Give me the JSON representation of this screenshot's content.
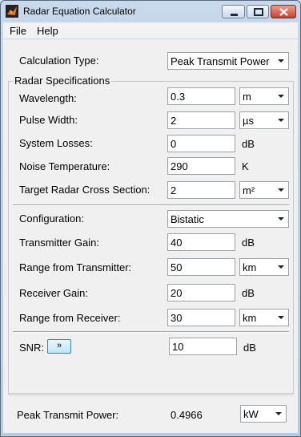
{
  "window": {
    "title": "Radar Equation Calculator",
    "minimize_icon": "minimize-icon",
    "maximize_icon": "maximize-icon",
    "close_icon": "close-icon",
    "close_color": "#c8412d"
  },
  "menu": {
    "file": "File",
    "help": "Help"
  },
  "calc_type": {
    "label": "Calculation Type:",
    "value": "Peak Transmit Power"
  },
  "specs": {
    "title": "Radar Specifications",
    "wavelength": {
      "label": "Wavelength:",
      "value": "0.3",
      "unit": "m"
    },
    "pulse_width": {
      "label": "Pulse Width:",
      "value": "2",
      "unit": "µs"
    },
    "system_losses": {
      "label": "System Losses:",
      "value": "0",
      "unit": "dB"
    },
    "noise_temp": {
      "label": "Noise Temperature:",
      "value": "290",
      "unit": "K"
    },
    "rcs": {
      "label": "Target Radar Cross Section:",
      "value": "2",
      "unit": "m²"
    },
    "configuration": {
      "label": "Configuration:",
      "value": "Bistatic"
    },
    "tx_gain": {
      "label": "Transmitter Gain:",
      "value": "40",
      "unit": "dB"
    },
    "range_tx": {
      "label": "Range from Transmitter:",
      "value": "50",
      "unit": "km"
    },
    "rx_gain": {
      "label": "Receiver Gain:",
      "value": "20",
      "unit": "dB"
    },
    "range_rx": {
      "label": "Range from Receiver:",
      "value": "30",
      "unit": "km"
    },
    "snr": {
      "label": "SNR:",
      "button": "»",
      "value": "10",
      "unit": "dB"
    }
  },
  "result": {
    "label": "Peak Transmit Power:",
    "value": "0.4966",
    "unit": "kW"
  }
}
